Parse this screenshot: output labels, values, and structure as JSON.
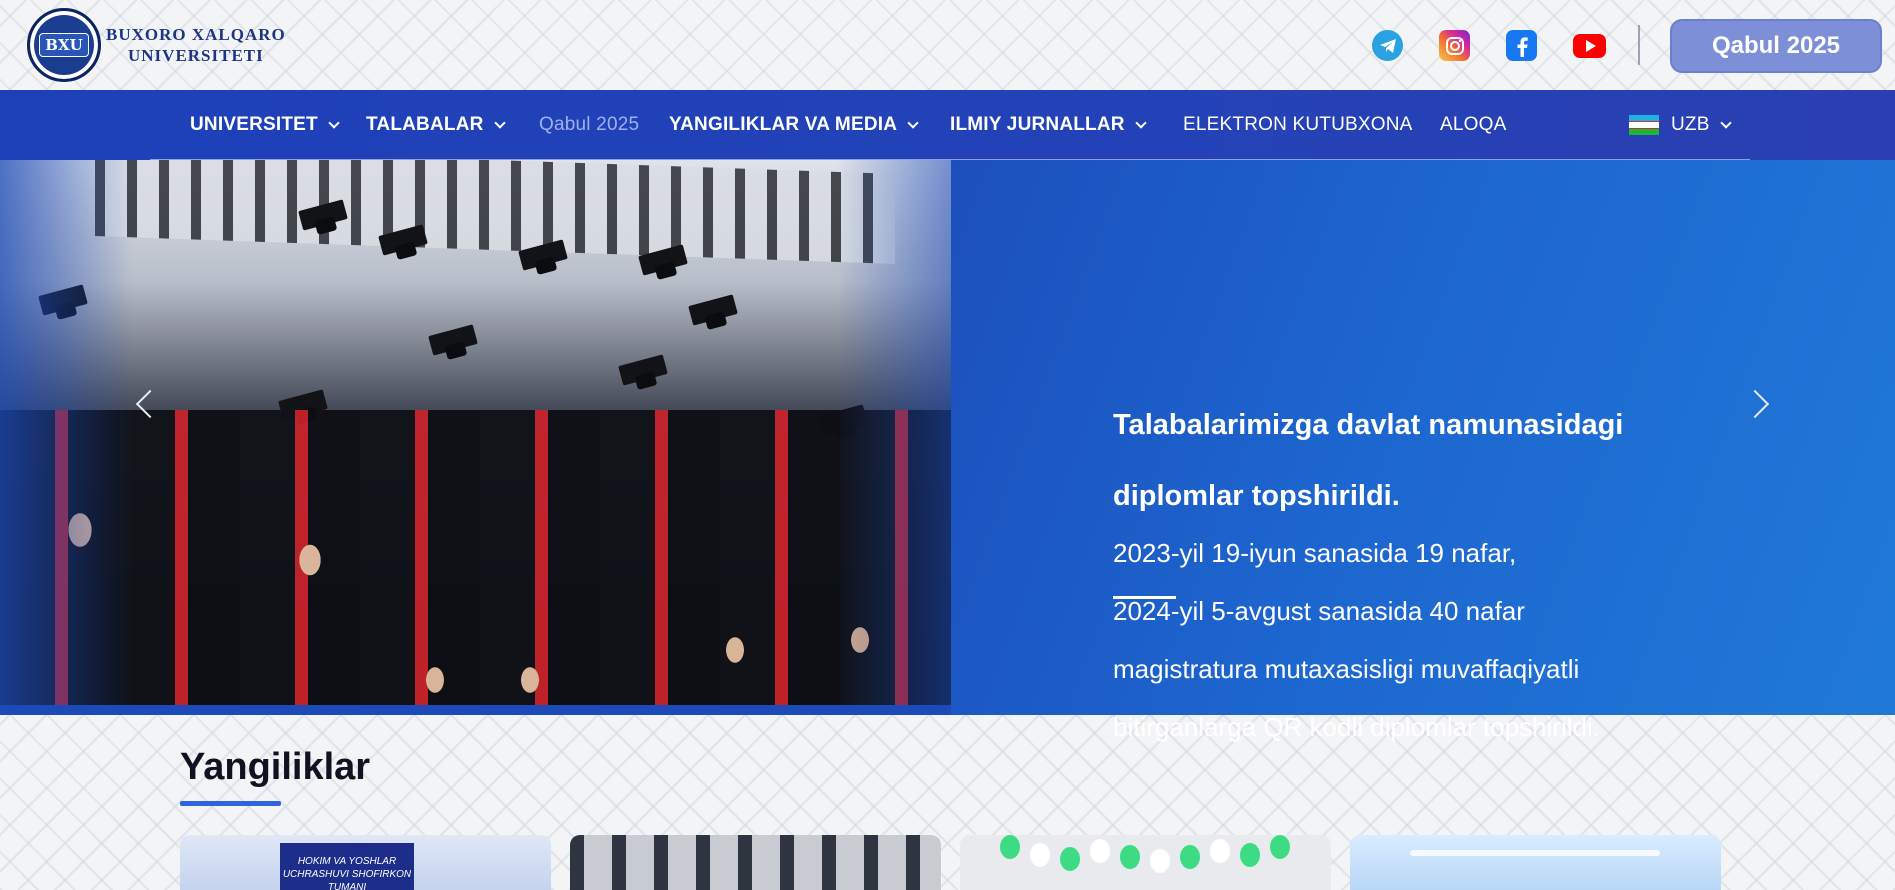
{
  "header": {
    "logo_seal_text": "BXU",
    "logo_line1": "BUXORO XALQARO",
    "logo_line2": "UNIVERSITETI",
    "socials": [
      "telegram-icon",
      "instagram-icon",
      "facebook-icon",
      "youtube-icon"
    ],
    "cta_label": "Qabul 2025"
  },
  "nav": {
    "items": [
      {
        "label": "UNIVERSITET"
      },
      {
        "label": "TALABALAR"
      },
      {
        "label": "Qabul 2025"
      },
      {
        "label": "YANGILIKLAR VA MEDIA"
      },
      {
        "label": "ILMIY JURNALLAR"
      },
      {
        "label": "ELEKTRON KUTUBXONA"
      },
      {
        "label": "ALOQA"
      }
    ],
    "language": "UZB"
  },
  "hero": {
    "title_line1": "Talabalarimizga davlat namunasidagi",
    "title_line2": "diplomlar topshirildi.",
    "body_lines": [
      "2023-yil 19-iyun sanasida 19 nafar,",
      "2024-yil 5-avgust sanasida 40 nafar",
      "magistratura mutaxasisligi muvaffaqiyatli",
      "bitirganlarga QR kodli diplomlar topshirildi."
    ]
  },
  "news": {
    "heading": "Yangiliklar",
    "card1_sign_text": "HOKIM VA YOSHLAR UCHRASHUVI SHOFIRKON TUMANI"
  },
  "colors": {
    "nav_bg": "#1d40b8",
    "hero_bg": "#1d66cf",
    "accent": "#2f63e0",
    "cta_bg": "#7d8fd6"
  }
}
